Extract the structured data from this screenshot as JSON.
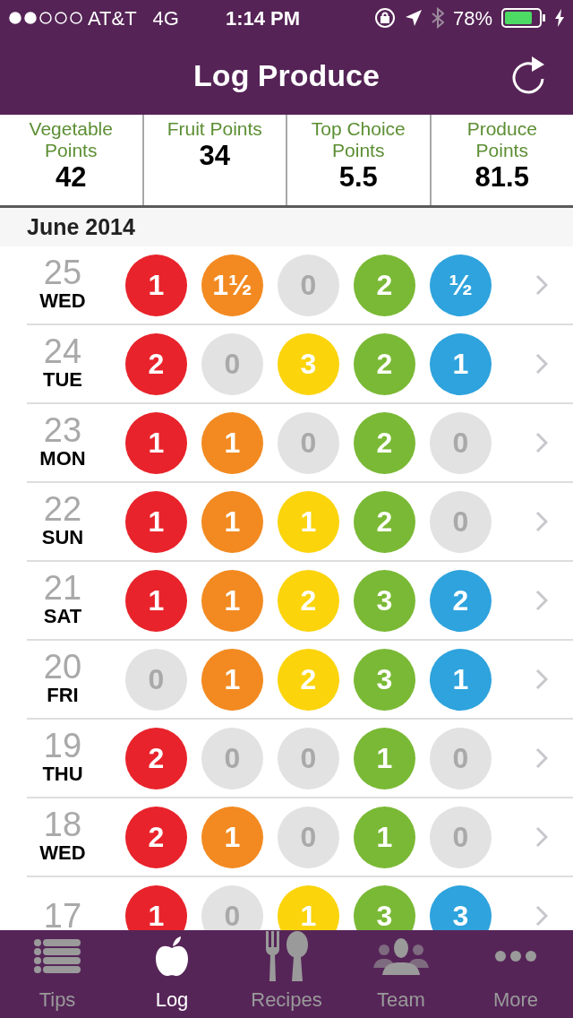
{
  "status_bar": {
    "carrier": "AT&T",
    "network": "4G",
    "time": "1:14 PM",
    "battery": "78%"
  },
  "nav": {
    "title": "Log Produce"
  },
  "summary": [
    {
      "label": "Vegetable Points",
      "value": "42"
    },
    {
      "label": "Fruit Points",
      "value": "34"
    },
    {
      "label": "Top Choice Points",
      "value": "5.5"
    },
    {
      "label": "Produce Points",
      "value": "81.5"
    }
  ],
  "section": "June 2014",
  "days": [
    {
      "day": "25",
      "weekday": "WED",
      "dots": [
        {
          "value": "1",
          "kind": "filled",
          "color": "#e8232b"
        },
        {
          "value": "1½",
          "kind": "filled",
          "color": "#f28a21"
        },
        {
          "value": "0",
          "kind": "zero",
          "color": "#e2e2e2"
        },
        {
          "value": "2",
          "kind": "filled",
          "color": "#7ab935"
        },
        {
          "value": "½",
          "kind": "filled",
          "color": "#2ea3dd"
        }
      ]
    },
    {
      "day": "24",
      "weekday": "TUE",
      "dots": [
        {
          "value": "2",
          "kind": "filled",
          "color": "#e8232b"
        },
        {
          "value": "0",
          "kind": "zero",
          "color": "#e2e2e2"
        },
        {
          "value": "3",
          "kind": "filled",
          "color": "#fbd40c"
        },
        {
          "value": "2",
          "kind": "filled",
          "color": "#7ab935"
        },
        {
          "value": "1",
          "kind": "filled",
          "color": "#2ea3dd"
        }
      ]
    },
    {
      "day": "23",
      "weekday": "MON",
      "dots": [
        {
          "value": "1",
          "kind": "filled",
          "color": "#e8232b"
        },
        {
          "value": "1",
          "kind": "filled",
          "color": "#f28a21"
        },
        {
          "value": "0",
          "kind": "zero",
          "color": "#e2e2e2"
        },
        {
          "value": "2",
          "kind": "filled",
          "color": "#7ab935"
        },
        {
          "value": "0",
          "kind": "zero",
          "color": "#e2e2e2"
        }
      ]
    },
    {
      "day": "22",
      "weekday": "SUN",
      "dots": [
        {
          "value": "1",
          "kind": "filled",
          "color": "#e8232b"
        },
        {
          "value": "1",
          "kind": "filled",
          "color": "#f28a21"
        },
        {
          "value": "1",
          "kind": "filled",
          "color": "#fbd40c"
        },
        {
          "value": "2",
          "kind": "filled",
          "color": "#7ab935"
        },
        {
          "value": "0",
          "kind": "zero",
          "color": "#e2e2e2"
        }
      ]
    },
    {
      "day": "21",
      "weekday": "SAT",
      "dots": [
        {
          "value": "1",
          "kind": "filled",
          "color": "#e8232b"
        },
        {
          "value": "1",
          "kind": "filled",
          "color": "#f28a21"
        },
        {
          "value": "2",
          "kind": "filled",
          "color": "#fbd40c"
        },
        {
          "value": "3",
          "kind": "filled",
          "color": "#7ab935"
        },
        {
          "value": "2",
          "kind": "filled",
          "color": "#2ea3dd"
        }
      ]
    },
    {
      "day": "20",
      "weekday": "FRI",
      "dots": [
        {
          "value": "0",
          "kind": "zero",
          "color": "#e2e2e2"
        },
        {
          "value": "1",
          "kind": "filled",
          "color": "#f28a21"
        },
        {
          "value": "2",
          "kind": "filled",
          "color": "#fbd40c"
        },
        {
          "value": "3",
          "kind": "filled",
          "color": "#7ab935"
        },
        {
          "value": "1",
          "kind": "filled",
          "color": "#2ea3dd"
        }
      ]
    },
    {
      "day": "19",
      "weekday": "THU",
      "dots": [
        {
          "value": "2",
          "kind": "filled",
          "color": "#e8232b"
        },
        {
          "value": "0",
          "kind": "zero",
          "color": "#e2e2e2"
        },
        {
          "value": "0",
          "kind": "zero",
          "color": "#e2e2e2"
        },
        {
          "value": "1",
          "kind": "filled",
          "color": "#7ab935"
        },
        {
          "value": "0",
          "kind": "zero",
          "color": "#e2e2e2"
        }
      ]
    },
    {
      "day": "18",
      "weekday": "WED",
      "dots": [
        {
          "value": "2",
          "kind": "filled",
          "color": "#e8232b"
        },
        {
          "value": "1",
          "kind": "filled",
          "color": "#f28a21"
        },
        {
          "value": "0",
          "kind": "zero",
          "color": "#e2e2e2"
        },
        {
          "value": "1",
          "kind": "filled",
          "color": "#7ab935"
        },
        {
          "value": "0",
          "kind": "zero",
          "color": "#e2e2e2"
        }
      ]
    },
    {
      "day": "17",
      "dots": [
        {
          "value": "1",
          "kind": "filled",
          "color": "#e8232b"
        },
        {
          "value": "0",
          "kind": "zero",
          "color": "#e2e2e2"
        },
        {
          "value": "1",
          "kind": "filled",
          "color": "#fbd40c"
        },
        {
          "value": "3",
          "kind": "filled",
          "color": "#7ab935"
        },
        {
          "value": "3",
          "kind": "filled",
          "color": "#2ea3dd"
        }
      ]
    }
  ],
  "tabs": [
    {
      "label": "Tips",
      "selected": false
    },
    {
      "label": "Log",
      "selected": true
    },
    {
      "label": "Recipes",
      "selected": false
    },
    {
      "label": "Team",
      "selected": false
    },
    {
      "label": "More",
      "selected": false
    }
  ]
}
